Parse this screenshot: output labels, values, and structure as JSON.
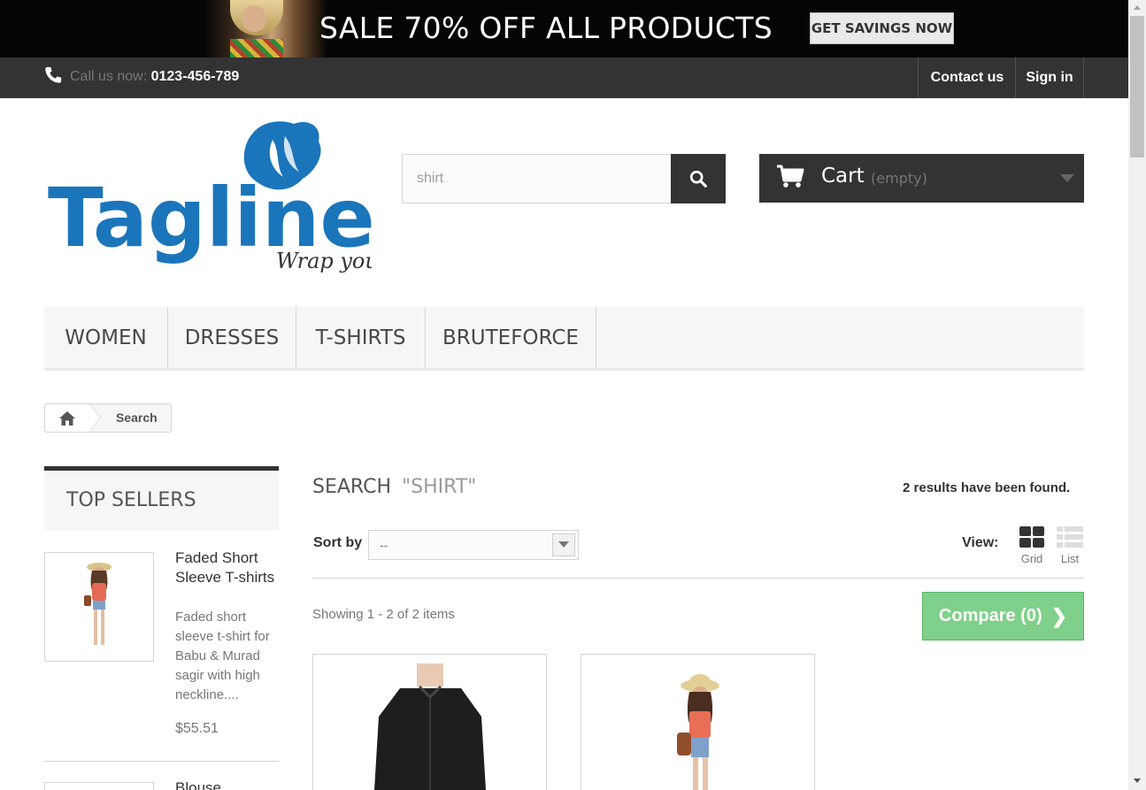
{
  "banner": {
    "headline": "SALE 70% OFF ALL PRODUCTS",
    "cta": "GET SAVINGS NOW"
  },
  "topbar": {
    "call_prefix": "Call us now:",
    "phone": "0123-456-789",
    "contact": "Contact us",
    "signin": "Sign in"
  },
  "logo": {
    "name": "Tagline",
    "tagline": "Wrap you",
    "color": "#1b75bb"
  },
  "search": {
    "value": "shirt",
    "icon": "search-icon"
  },
  "cart": {
    "label": "Cart",
    "status": "(empty)",
    "icon": "shopping-cart-icon"
  },
  "menu": {
    "items": [
      "WOMEN",
      "DRESSES",
      "T-SHIRTS",
      "BRUTEFORCE"
    ]
  },
  "breadcrumb": {
    "home_icon": "home-icon",
    "current": "Search"
  },
  "sidebar": {
    "title": "TOP SELLERS",
    "items": [
      {
        "name": "Faded Short Sleeve T-shirts",
        "description": "Faded short sleeve t-shirt for Babu & Murad sagir with high neckline....",
        "price": "$55.51"
      },
      {
        "name": "Blouse"
      }
    ]
  },
  "main": {
    "heading": "SEARCH",
    "query": "\"SHIRT\"",
    "results": "2 results have been found.",
    "sort_label": "Sort by",
    "sort_value": "--",
    "view_label": "View:",
    "view_grid": "Grid",
    "view_list": "List",
    "showing": "Showing 1 - 2 of 2 items",
    "compare": "Compare (0)",
    "compare_color": "#7fd08a"
  }
}
